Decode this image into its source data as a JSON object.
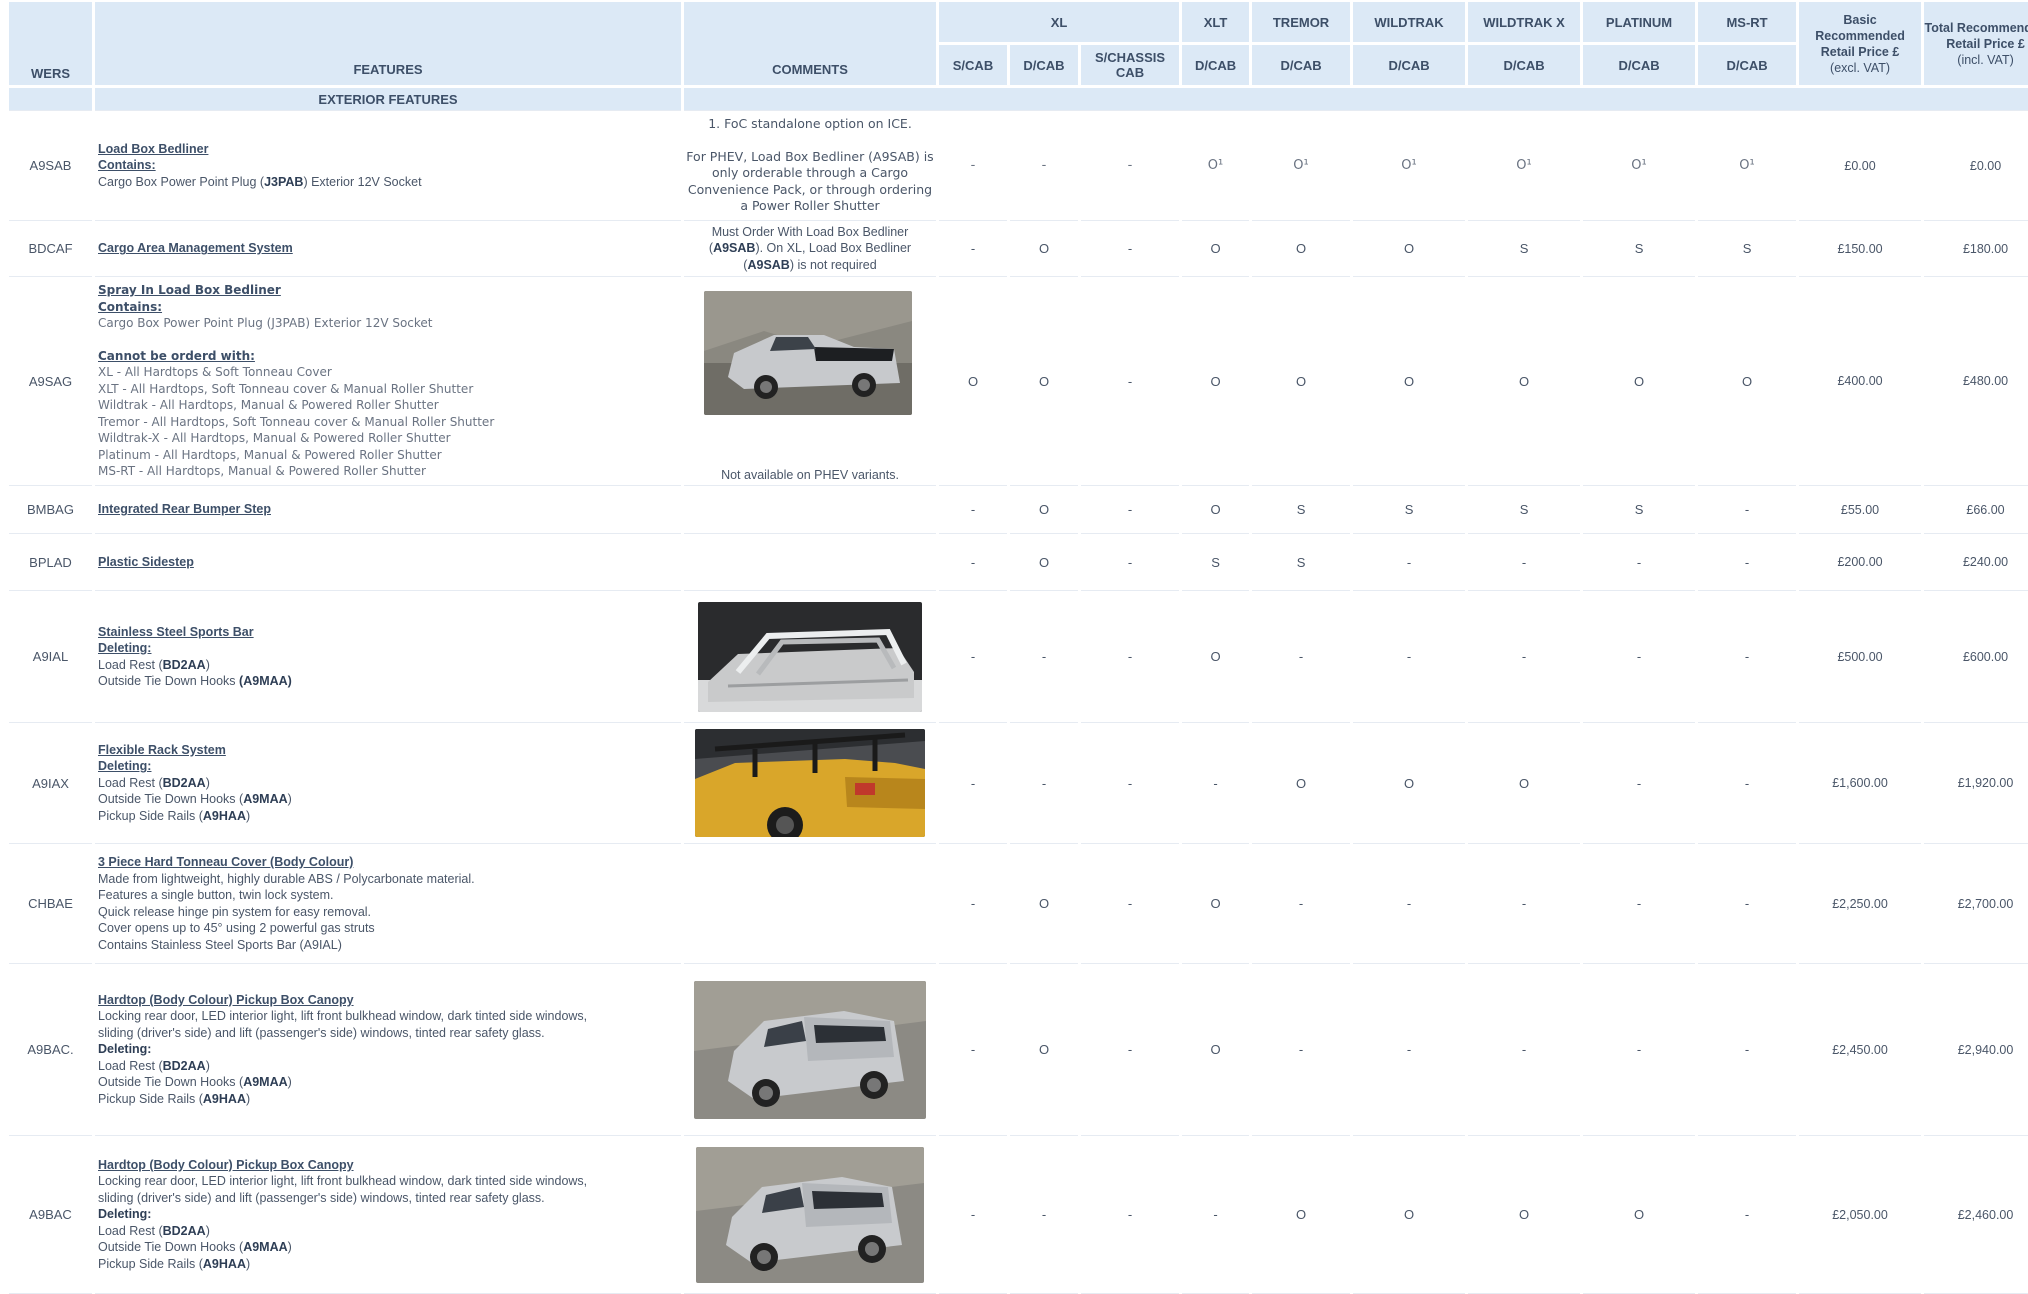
{
  "header": {
    "wers": "WERS",
    "features": "FEATURES",
    "comments": "COMMENTS",
    "groups": [
      "XL",
      "XLT",
      "TREMOR",
      "WILDTRAK",
      "WILDTRAK X",
      "PLATINUM",
      "MS-RT"
    ],
    "subcols": [
      "S/CAB",
      "D/CAB",
      "S/CHASSIS CAB",
      "D/CAB",
      "D/CAB",
      "D/CAB",
      "D/CAB",
      "D/CAB",
      "D/CAB"
    ],
    "basic_price_title": "Basic Recommended Retail Price £",
    "basic_price_sub": "(excl. VAT)",
    "total_price_title": "Total Recommended Retail Price £",
    "total_price_sub": "(incl. VAT)"
  },
  "section_title": "EXTERIOR FEATURES",
  "rows": [
    {
      "wers": "A9SAB",
      "title": "Load Box Bedliner",
      "contains_label": "Contains:",
      "line1_a": "Cargo Box Power Point Plug (",
      "line1_b": "J3PAB",
      "line1_c": ") Exterior 12V Socket",
      "comment_1": "1. FoC standalone option on ICE.",
      "comment_2": "For PHEV, Load Box Bedliner (A9SAB) is only orderable through a Cargo Convenience Pack, or through ordering a Power Roller Shutter",
      "values": [
        "-",
        "-",
        "-",
        "O¹",
        "O¹",
        "O¹",
        "O¹",
        "O¹",
        "O¹"
      ],
      "basic": "£0.00",
      "total": "£0.00"
    },
    {
      "wers": "BDCAF",
      "title": "Cargo Area Management System",
      "comment_a": "Must Order With Load Box Bedliner (",
      "comment_b": "A9SAB",
      "comment_c": "). On XL, Load Box Bedliner (",
      "comment_d": "A9SAB",
      "comment_e": ") is not required",
      "values": [
        "-",
        "O",
        "-",
        "O",
        "O",
        "O",
        "S",
        "S",
        "S"
      ],
      "basic": "£150.00",
      "total": "£180.00"
    },
    {
      "wers": "A9SAG",
      "title": "Spray In Load Box Bedliner",
      "contains_label": "Contains:",
      "contains_line": "Cargo Box Power Point Plug (J3PAB) Exterior 12V Socket",
      "cannot_label": "Cannot be orderd with:",
      "cannot_lines": [
        "XL  - All Hardtops & Soft Tonneau Cover",
        "XLT - All Hardtops,  Soft Tonneau cover & Manual Roller Shutter",
        "Wildtrak - All Hardtops, Manual & Powered Roller Shutter",
        "Tremor - All Hardtops, Soft Tonneau cover & Manual Roller Shutter",
        "Wildtrak-X -  All Hardtops, Manual & Powered Roller Shutter",
        "Platinum -  All Hardtops, Manual & Powered Roller Shutter",
        "MS-RT - All Hardtops, Manual & Powered Roller Shutter"
      ],
      "comment": "Not available on PHEV variants.",
      "values": [
        "O",
        "O",
        "-",
        "O",
        "O",
        "O",
        "O",
        "O",
        "O"
      ],
      "basic": "£400.00",
      "total": "£480.00"
    },
    {
      "wers": "BMBAG",
      "title": "Integrated Rear Bumper Step",
      "values": [
        "-",
        "O",
        "-",
        "O",
        "S",
        "S",
        "S",
        "S",
        "-"
      ],
      "basic": "£55.00",
      "total": "£66.00"
    },
    {
      "wers": "BPLAD",
      "title": "Plastic Sidestep",
      "values": [
        "-",
        "O",
        "-",
        "S",
        "S",
        "-",
        "-",
        "-",
        "-"
      ],
      "basic": "£200.00",
      "total": "£240.00"
    },
    {
      "wers": "A9IAL",
      "title": "Stainless Steel Sports Bar",
      "deleting_label": "Deleting:",
      "d1_a": "Load Rest (",
      "d1_b": "BD2AA",
      "d1_c": ")",
      "d2_a": "Outside Tie Down Hooks ",
      "d2_b": "(A9MAA)",
      "values": [
        "-",
        "-",
        "-",
        "O",
        "-",
        "-",
        "-",
        "-",
        "-"
      ],
      "basic": "£500.00",
      "total": "£600.00"
    },
    {
      "wers": "A9IAX",
      "title": "Flexible Rack System",
      "deleting_label": "Deleting:",
      "d1_a": "Load Rest (",
      "d1_b": "BD2AA",
      "d1_c": ")",
      "d2_a": "Outside Tie Down Hooks (",
      "d2_b": "A9MAA",
      "d2_c": ")",
      "d3_a": "Pickup Side Rails (",
      "d3_b": "A9HAA",
      "d3_c": ")",
      "values": [
        "-",
        "-",
        "-",
        "-",
        "O",
        "O",
        "O",
        "-",
        "-"
      ],
      "basic": "£1,600.00",
      "total": "£1,920.00"
    },
    {
      "wers": "CHBAE",
      "title": "3 Piece Hard Tonneau Cover (Body Colour)",
      "lines": [
        "Made from lightweight, highly durable ABS / Polycarbonate material.",
        "Features a single button, twin lock system.",
        "Quick release hinge pin system for easy removal.",
        "Cover opens up to 45° using 2 powerful gas struts",
        "Contains Stainless Steel Sports Bar (A9IAL)"
      ],
      "values": [
        "-",
        "O",
        "-",
        "O",
        "-",
        "-",
        "-",
        "-",
        "-"
      ],
      "basic": "£2,250.00",
      "total": "£2,700.00"
    },
    {
      "wers": "A9BAC.",
      "title": "Hardtop (Body Colour) Pickup Box Canopy",
      "desc1": "Locking rear door, LED interior light, lift front bulkhead window, dark tinted side windows,",
      "desc2": "sliding (driver's side) and lift (passenger's side) windows, tinted rear safety glass.",
      "deleting_label": "Deleting:",
      "d1_a": "Load Rest (",
      "d1_b": "BD2AA",
      "d1_c": ")",
      "d2_a": "Outside Tie Down Hooks (",
      "d2_b": "A9MAA",
      "d2_c": ")",
      "d3_a": "Pickup Side Rails (",
      "d3_b": "A9HAA",
      "d3_c": ")",
      "values": [
        "-",
        "O",
        "-",
        "O",
        "-",
        "-",
        "-",
        "-",
        "-"
      ],
      "basic": "£2,450.00",
      "total": "£2,940.00"
    },
    {
      "wers": "A9BAC",
      "title": "Hardtop (Body Colour) Pickup Box Canopy",
      "desc1": "Locking rear door, LED interior light, lift front bulkhead window, dark tinted side windows,",
      "desc2": "sliding (driver's side) and lift (passenger's side) windows, tinted rear safety glass.",
      "deleting_label": "Deleting:",
      "d1_a": "Load Rest (",
      "d1_b": "BD2AA",
      "d1_c": ")",
      "d2_a": "Outside Tie Down Hooks (",
      "d2_b": "A9MAA",
      "d2_c": ")",
      "d3_a": "Pickup Side Rails (",
      "d3_b": "A9HAA",
      "d3_c": ")",
      "values": [
        "-",
        "-",
        "-",
        "-",
        "O",
        "O",
        "O",
        "O",
        "-"
      ],
      "basic": "£2,050.00",
      "total": "£2,460.00"
    }
  ]
}
